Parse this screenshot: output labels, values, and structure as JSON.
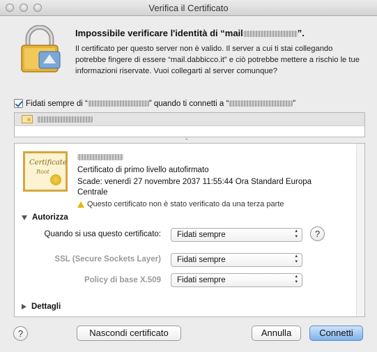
{
  "window": {
    "title": "Verifica il Certificato"
  },
  "header": {
    "headline_prefix": "Impossibile verificare l'identità di “mail",
    "headline_suffix": "”.",
    "description": "Il certificato per questo server non è valido. Il server a cui ti stai collegando potrebbe fingere di essere “mail.dabbicco.it” e ciò potrebbe mettere a rischio le tue informazioni riservate. Vuoi collegarti al server comunque?"
  },
  "trust": {
    "checked": true,
    "label_part1": "Fidati sempre di “",
    "label_part2": "” quando ti connetti a “",
    "label_part3": "”"
  },
  "certificate": {
    "type": "Certificato di primo livello autofirmato",
    "expiry": "Scade: venerdì 27 novembre 2037 11:55:44 Ora Standard Europa Centrale",
    "warning": "Questo certificato non è stato verificato da una terza parte",
    "icon_word": "Certificate",
    "icon_sub": "Root"
  },
  "trust_settings": {
    "section_label": "Autorizza",
    "when_using_label": "Quando si usa questo certificato:",
    "when_using_value": "Fidati sempre",
    "ssl_label": "SSL (Secure Sockets Layer)",
    "ssl_value": "Fidati sempre",
    "x509_label": "Policy di base X.509",
    "x509_value": "Fidati sempre"
  },
  "details": {
    "section_label": "Dettagli"
  },
  "buttons": {
    "help": "?",
    "hide_cert": "Nascondi certificato",
    "cancel": "Annulla",
    "connect": "Connetti"
  }
}
